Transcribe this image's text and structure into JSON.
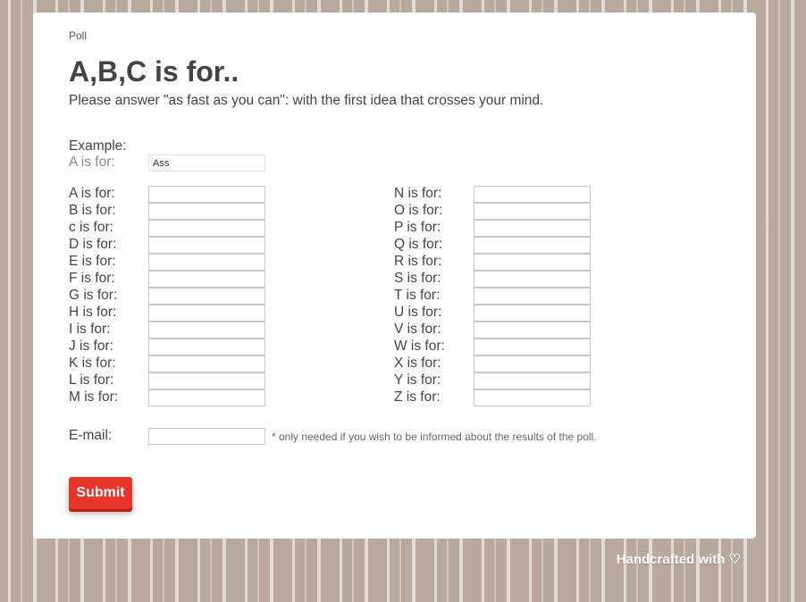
{
  "breadcrumb": "Poll",
  "title": "A,B,C is for..",
  "subtitle": "Please answer \"as fast as you can\": with the first idea that crosses your mind.",
  "example": {
    "heading": "Example:",
    "label": "A is for:",
    "value": "Ass"
  },
  "left_rows": [
    {
      "label": "A is for:",
      "value": ""
    },
    {
      "label": "B is for:",
      "value": ""
    },
    {
      "label": "c is for:",
      "value": ""
    },
    {
      "label": "D is for:",
      "value": ""
    },
    {
      "label": "E is for:",
      "value": ""
    },
    {
      "label": "F is for:",
      "value": ""
    },
    {
      "label": "G is for:",
      "value": ""
    },
    {
      "label": "H is for:",
      "value": ""
    },
    {
      "label": "I is for:",
      "value": ""
    },
    {
      "label": "J is for:",
      "value": ""
    },
    {
      "label": "K is for:",
      "value": ""
    },
    {
      "label": "L is for:",
      "value": ""
    },
    {
      "label": "M is for:",
      "value": ""
    }
  ],
  "right_rows": [
    {
      "label": "N is for:",
      "value": ""
    },
    {
      "label": "O is for:",
      "value": ""
    },
    {
      "label": "P is for:",
      "value": ""
    },
    {
      "label": "Q is for:",
      "value": ""
    },
    {
      "label": "R is for:",
      "value": ""
    },
    {
      "label": "S is for:",
      "value": ""
    },
    {
      "label": "T is for:",
      "value": ""
    },
    {
      "label": "U is for:",
      "value": ""
    },
    {
      "label": "V is for:",
      "value": ""
    },
    {
      "label": "W is for:",
      "value": ""
    },
    {
      "label": "X is for:",
      "value": ""
    },
    {
      "label": "Y is for:",
      "value": ""
    },
    {
      "label": "Z is for:",
      "value": ""
    }
  ],
  "email": {
    "label": "E-mail:",
    "value": "",
    "note": "* only needed if you wish to be informed about the results of the poll."
  },
  "submit_label": "Submit",
  "footer": {
    "text": "Handcrafted with",
    "icon": "heart-outline-icon"
  },
  "colors": {
    "accent": "#e8352a",
    "background": "#b8a89d",
    "text": "#444444"
  }
}
